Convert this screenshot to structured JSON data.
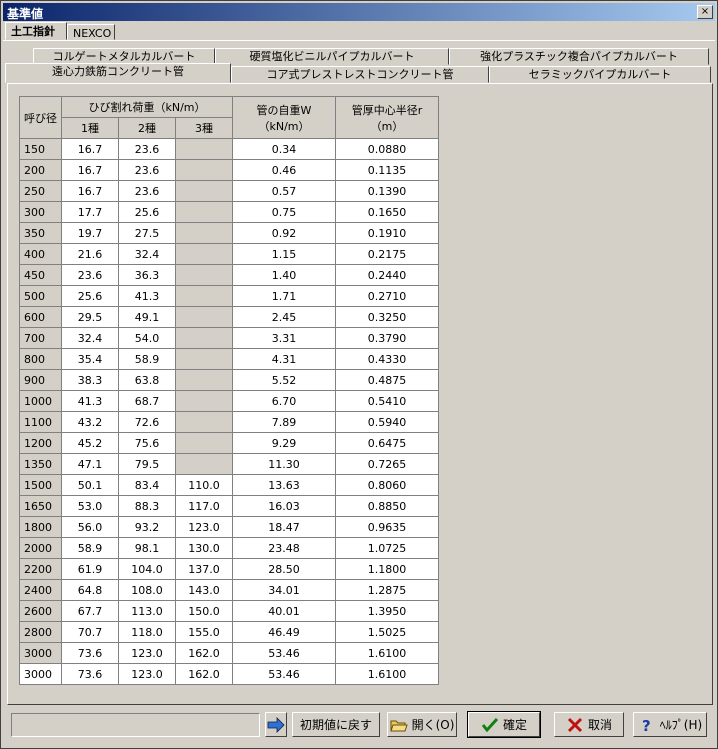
{
  "window": {
    "title": "基準値",
    "close": "×"
  },
  "top_tabs": [
    "土工指針",
    "NEXCO"
  ],
  "sub_tabs_row1": [
    "コルゲートメタルカルバート",
    "硬質塩化ビニルパイプカルバート",
    "強化プラスチック複合パイプカルバート"
  ],
  "sub_tabs_row2": [
    "遠心力鉄筋コンクリート管",
    "コア式プレストレストコンクリート管",
    "セラミックパイプカルバート"
  ],
  "table": {
    "h_size": "呼び径",
    "h_crack": "ひび割れ荷重（kN/m）",
    "h_t1": "1種",
    "h_t2": "2種",
    "h_t3": "3種",
    "h_weight": "管の自重W（kN/m）",
    "h_radius": "管厚中心半径r（m）",
    "rows": [
      [
        "150",
        "16.7",
        "23.6",
        "",
        "0.34",
        "0.0880"
      ],
      [
        "200",
        "16.7",
        "23.6",
        "",
        "0.46",
        "0.1135"
      ],
      [
        "250",
        "16.7",
        "23.6",
        "",
        "0.57",
        "0.1390"
      ],
      [
        "300",
        "17.7",
        "25.6",
        "",
        "0.75",
        "0.1650"
      ],
      [
        "350",
        "19.7",
        "27.5",
        "",
        "0.92",
        "0.1910"
      ],
      [
        "400",
        "21.6",
        "32.4",
        "",
        "1.15",
        "0.2175"
      ],
      [
        "450",
        "23.6",
        "36.3",
        "",
        "1.40",
        "0.2440"
      ],
      [
        "500",
        "25.6",
        "41.3",
        "",
        "1.71",
        "0.2710"
      ],
      [
        "600",
        "29.5",
        "49.1",
        "",
        "2.45",
        "0.3250"
      ],
      [
        "700",
        "32.4",
        "54.0",
        "",
        "3.31",
        "0.3790"
      ],
      [
        "800",
        "35.4",
        "58.9",
        "",
        "4.31",
        "0.4330"
      ],
      [
        "900",
        "38.3",
        "63.8",
        "",
        "5.52",
        "0.4875"
      ],
      [
        "1000",
        "41.3",
        "68.7",
        "",
        "6.70",
        "0.5410"
      ],
      [
        "1100",
        "43.2",
        "72.6",
        "",
        "7.89",
        "0.5940"
      ],
      [
        "1200",
        "45.2",
        "75.6",
        "",
        "9.29",
        "0.6475"
      ],
      [
        "1350",
        "47.1",
        "79.5",
        "",
        "11.30",
        "0.7265"
      ],
      [
        "1500",
        "50.1",
        "83.4",
        "110.0",
        "13.63",
        "0.8060"
      ],
      [
        "1650",
        "53.0",
        "88.3",
        "117.0",
        "16.03",
        "0.8850"
      ],
      [
        "1800",
        "56.0",
        "93.2",
        "123.0",
        "18.47",
        "0.9635"
      ],
      [
        "2000",
        "58.9",
        "98.1",
        "130.0",
        "23.48",
        "1.0725"
      ],
      [
        "2200",
        "61.9",
        "104.0",
        "137.0",
        "28.50",
        "1.1800"
      ],
      [
        "2400",
        "64.8",
        "108.0",
        "143.0",
        "34.01",
        "1.2875"
      ],
      [
        "2600",
        "67.7",
        "113.0",
        "150.0",
        "40.01",
        "1.3950"
      ],
      [
        "2800",
        "70.7",
        "118.0",
        "155.0",
        "46.49",
        "1.5025"
      ],
      [
        "3000",
        "73.6",
        "123.0",
        "162.0",
        "53.46",
        "1.6100"
      ],
      [
        "3000",
        "73.6",
        "123.0",
        "162.0",
        "53.46",
        "1.6100"
      ]
    ]
  },
  "buttons": {
    "reset": "初期値に戻す",
    "open": "開く(O)",
    "ok": "確定",
    "cancel": "取消",
    "help": "ﾍﾙﾌﾟ(H)"
  }
}
